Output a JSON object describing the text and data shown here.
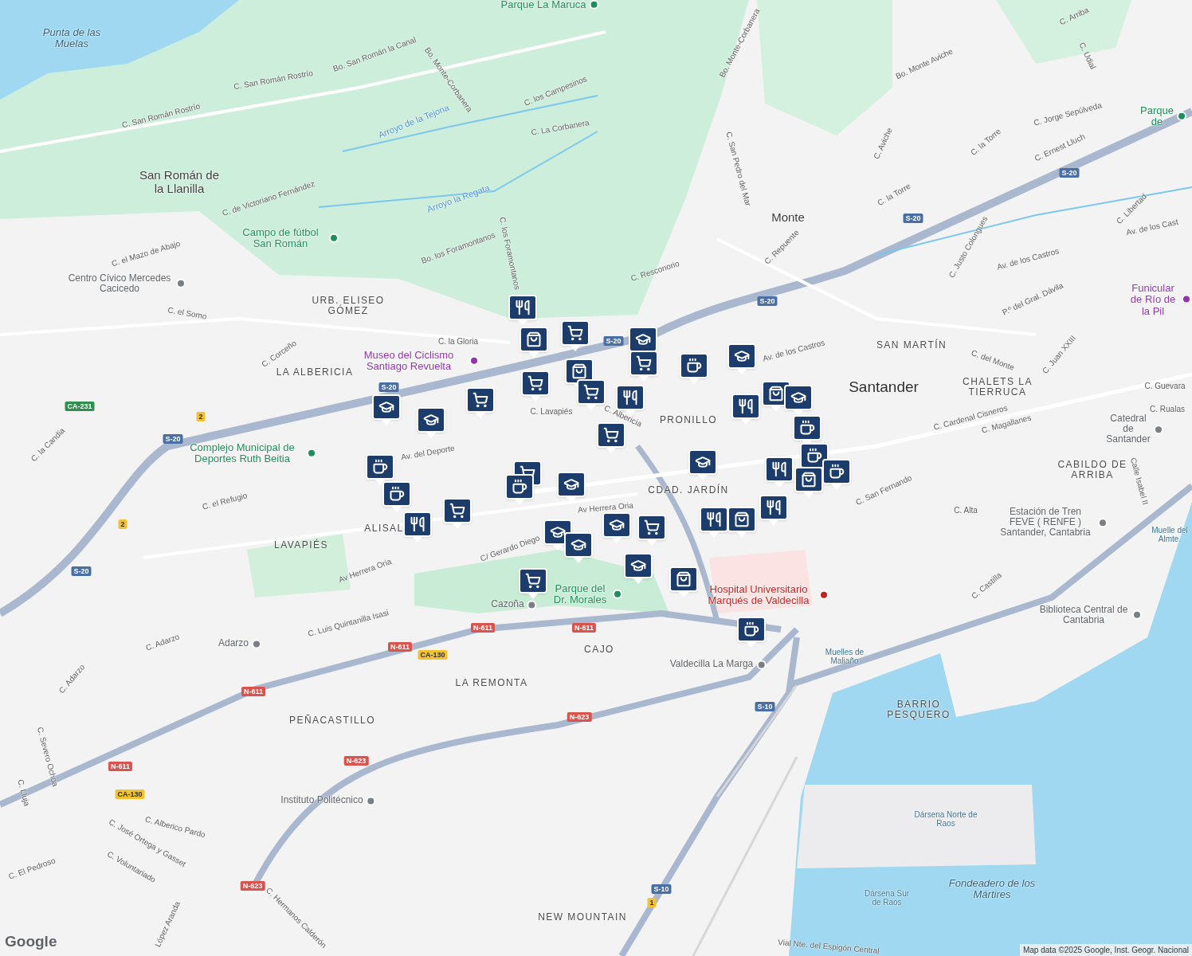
{
  "labels": [
    {
      "text": "Punta de las Muelas",
      "kind": "water"
    },
    {
      "text": "Parque La Maruca",
      "kind": "poi_green"
    },
    {
      "text": "C. San Román Rostrío",
      "kind": "street"
    },
    {
      "text": "C. San Román Rostrío",
      "kind": "street"
    },
    {
      "text": "Bo. San Román la Canal",
      "kind": "street"
    },
    {
      "text": "Bo. Monte-Corbanera",
      "kind": "street"
    },
    {
      "text": "Bo. Monte-Corbanera",
      "kind": "street"
    },
    {
      "text": "C. los Campesinos",
      "kind": "street"
    },
    {
      "text": "C. La Corbanera",
      "kind": "street"
    },
    {
      "text": "Arroyo de la Tejona",
      "kind": "stream"
    },
    {
      "text": "Arroyo la Regata",
      "kind": "stream"
    },
    {
      "text": "San Román de la Llanilla",
      "kind": "place"
    },
    {
      "text": "C. de Victoriano Fernández",
      "kind": "street"
    },
    {
      "text": "Campo de fútbol San Román",
      "kind": "poi_green"
    },
    {
      "text": "C. el Mazo de Abajo",
      "kind": "street"
    },
    {
      "text": "Centro Cívico Mercedes Cacicedo",
      "kind": "poi_gray"
    },
    {
      "text": "C. el Somo",
      "kind": "street"
    },
    {
      "text": "Bo. los Foramontanos",
      "kind": "street"
    },
    {
      "text": "C. los Foramontanos",
      "kind": "street"
    },
    {
      "text": "URB. ELISEO GÓMEZ",
      "kind": "district"
    },
    {
      "text": "Museo del Ciclismo Santiago Revuelta",
      "kind": "poi_purple"
    },
    {
      "text": "C. la Gloria",
      "kind": "street"
    },
    {
      "text": "C. Corceño",
      "kind": "street"
    },
    {
      "text": "LA ALBERICIA",
      "kind": "district"
    },
    {
      "text": "C. San Pedro del Mar",
      "kind": "street"
    },
    {
      "text": "C. Resconorio",
      "kind": "street"
    },
    {
      "text": "C. Repuente",
      "kind": "street"
    },
    {
      "text": "Monte",
      "kind": "place"
    },
    {
      "text": "Bo. Monte Aviche",
      "kind": "street"
    },
    {
      "text": "C. Aviche",
      "kind": "street"
    },
    {
      "text": "C. la Torre",
      "kind": "street"
    },
    {
      "text": "C. la Torre",
      "kind": "street"
    },
    {
      "text": "C. Arriba",
      "kind": "street"
    },
    {
      "text": "C. Udial",
      "kind": "street"
    },
    {
      "text": "C. Jorge Sepúlveda",
      "kind": "street"
    },
    {
      "text": "C. Ernest Lluch",
      "kind": "street"
    },
    {
      "text": "Parque de",
      "kind": "poi_green"
    },
    {
      "text": "C. Justo Colongues",
      "kind": "street"
    },
    {
      "text": "Av. de los Castros",
      "kind": "street"
    },
    {
      "text": "C. Libertad",
      "kind": "street"
    },
    {
      "text": "Av. de los Cast",
      "kind": "street"
    },
    {
      "text": "Funicular de Río de la Pil",
      "kind": "poi_purple"
    },
    {
      "text": "P.º del Gral. Dávila",
      "kind": "street"
    },
    {
      "text": "SAN MARTÍN",
      "kind": "district"
    },
    {
      "text": "C. Juan XXIII",
      "kind": "street"
    },
    {
      "text": "C. del Monte",
      "kind": "street"
    },
    {
      "text": "Santander",
      "kind": "city"
    },
    {
      "text": "CHALETS LA TIERRUCA",
      "kind": "district"
    },
    {
      "text": "C. Guevara",
      "kind": "street"
    },
    {
      "text": "C. Rualas",
      "kind": "street"
    },
    {
      "text": "C. Cardenal Cisneros",
      "kind": "street"
    },
    {
      "text": "C. Magallanes",
      "kind": "street"
    },
    {
      "text": "Catedral de Santander",
      "kind": "poi_gray"
    },
    {
      "text": "CABILDO DE ARRIBA",
      "kind": "district"
    },
    {
      "text": "Calle Isabel II",
      "kind": "street"
    },
    {
      "text": "C. San Fernando",
      "kind": "street"
    },
    {
      "text": "C. Alta",
      "kind": "street"
    },
    {
      "text": "Estación de Tren FEVE ( RENFE ) Santander, Cantabria",
      "kind": "poi_gray"
    },
    {
      "text": "Muelle del Almte.",
      "kind": "water_small"
    },
    {
      "text": "C. Castilla",
      "kind": "street"
    },
    {
      "text": "Biblioteca Central de Cantabria",
      "kind": "poi_gray"
    },
    {
      "text": "Muelles de Maliaño",
      "kind": "water_small"
    },
    {
      "text": "BARRIO PESQUERO",
      "kind": "district"
    },
    {
      "text": "Dársena Norte de Raos",
      "kind": "water_small"
    },
    {
      "text": "Dársena Sur de Raos",
      "kind": "water_small"
    },
    {
      "text": "Fondeadero de los Mártires",
      "kind": "water"
    },
    {
      "text": "Vial Nte. del Espigón Central",
      "kind": "street"
    },
    {
      "text": "NEW MOUNTAIN",
      "kind": "district"
    },
    {
      "text": "PRONILLO",
      "kind": "district"
    },
    {
      "text": "CDAD. JARDÍN",
      "kind": "district"
    },
    {
      "text": "Hospital Universitario Marqués de Valdecilla",
      "kind": "poi_red"
    },
    {
      "text": "Valdecilla La Marga",
      "kind": "poi_gray"
    },
    {
      "text": "C. Lavapiés",
      "kind": "street"
    },
    {
      "text": "C. Albericia",
      "kind": "street"
    },
    {
      "text": "Av Herrera Oria",
      "kind": "street"
    },
    {
      "text": "C/ Gerardo Diego",
      "kind": "street"
    },
    {
      "text": "Parque del Dr. Morales",
      "kind": "poi_green"
    },
    {
      "text": "Cazoña",
      "kind": "poi_gray"
    },
    {
      "text": "CAJO",
      "kind": "district"
    },
    {
      "text": "LA REMONTA",
      "kind": "district"
    },
    {
      "text": "PEÑACASTILLO",
      "kind": "district"
    },
    {
      "text": "C. Luis Quintanilla Isasi",
      "kind": "street"
    },
    {
      "text": "Adarzo",
      "kind": "poi_gray"
    },
    {
      "text": "C. Adarzo",
      "kind": "street"
    },
    {
      "text": "C. Adarzo",
      "kind": "street"
    },
    {
      "text": "Av Herrera Oria",
      "kind": "street"
    },
    {
      "text": "LAVAPIÉS",
      "kind": "district"
    },
    {
      "text": "ALISAL",
      "kind": "district"
    },
    {
      "text": "C. el Refugio",
      "kind": "street"
    },
    {
      "text": "Av. del Deporte",
      "kind": "street"
    },
    {
      "text": "Complejo Municipal de Deportes Ruth Beitia",
      "kind": "poi_green"
    },
    {
      "text": "C. la Candia",
      "kind": "street"
    },
    {
      "text": "C. Severo Ochoa",
      "kind": "street"
    },
    {
      "text": "C. Lluja",
      "kind": "street"
    },
    {
      "text": "Instituto Politécnico",
      "kind": "poi_gray"
    },
    {
      "text": "C. Alberico Pardo",
      "kind": "street"
    },
    {
      "text": "C. José Ortega y Gasset",
      "kind": "street"
    },
    {
      "text": "C. Voluntariado",
      "kind": "street"
    },
    {
      "text": "C. El Pedroso",
      "kind": "street"
    },
    {
      "text": "López Aranda",
      "kind": "street"
    },
    {
      "text": "C. Hermanos Calderón",
      "kind": "street"
    },
    {
      "text": "Av. de los Castros",
      "kind": "street"
    }
  ],
  "roads": [
    {
      "text": "S-20",
      "kind": "autovia"
    },
    {
      "text": "S-20",
      "kind": "autovia"
    },
    {
      "text": "S-20",
      "kind": "autovia"
    },
    {
      "text": "S-20",
      "kind": "autovia"
    },
    {
      "text": "S-20",
      "kind": "autovia"
    },
    {
      "text": "S-20",
      "kind": "autovia"
    },
    {
      "text": "S-20",
      "kind": "autovia"
    },
    {
      "text": "N-611",
      "kind": "nacional"
    },
    {
      "text": "N-611",
      "kind": "nacional"
    },
    {
      "text": "N-611",
      "kind": "nacional"
    },
    {
      "text": "N-611",
      "kind": "nacional"
    },
    {
      "text": "N-611",
      "kind": "nacional"
    },
    {
      "text": "N-623",
      "kind": "nacional"
    },
    {
      "text": "N-623",
      "kind": "nacional"
    },
    {
      "text": "N-623",
      "kind": "nacional"
    },
    {
      "text": "CA-130",
      "kind": "autonomica"
    },
    {
      "text": "CA-130",
      "kind": "autonomica"
    },
    {
      "text": "CA-231",
      "kind": "regional"
    },
    {
      "text": "S-10",
      "kind": "autovia"
    },
    {
      "text": "S-10",
      "kind": "autovia"
    },
    {
      "text": "2",
      "kind": "local"
    },
    {
      "text": "2",
      "kind": "local"
    },
    {
      "text": "1",
      "kind": "local"
    }
  ],
  "markers": [
    {
      "kind": "restaurant"
    },
    {
      "kind": "shop"
    },
    {
      "kind": "grocery"
    },
    {
      "kind": "school"
    },
    {
      "kind": "grocery"
    },
    {
      "kind": "cafe"
    },
    {
      "kind": "school"
    },
    {
      "kind": "grocery"
    },
    {
      "kind": "shop"
    },
    {
      "kind": "grocery"
    },
    {
      "kind": "restaurant"
    },
    {
      "kind": "grocery"
    },
    {
      "kind": "school"
    },
    {
      "kind": "school"
    },
    {
      "kind": "grocery"
    },
    {
      "kind": "restaurant"
    },
    {
      "kind": "shop"
    },
    {
      "kind": "school"
    },
    {
      "kind": "cafe"
    },
    {
      "kind": "cafe"
    },
    {
      "kind": "cafe"
    },
    {
      "kind": "shop"
    },
    {
      "kind": "restaurant"
    },
    {
      "kind": "school"
    },
    {
      "kind": "restaurant"
    },
    {
      "kind": "shop"
    },
    {
      "kind": "restaurant"
    },
    {
      "kind": "cafe"
    },
    {
      "kind": "cafe"
    },
    {
      "kind": "grocery"
    },
    {
      "kind": "cafe"
    },
    {
      "kind": "school"
    },
    {
      "kind": "grocery"
    },
    {
      "kind": "restaurant"
    },
    {
      "kind": "school"
    },
    {
      "kind": "school"
    },
    {
      "kind": "school"
    },
    {
      "kind": "grocery"
    },
    {
      "kind": "school"
    },
    {
      "kind": "shop"
    },
    {
      "kind": "grocery"
    },
    {
      "kind": "cafe"
    }
  ],
  "attribution": {
    "logo": "Google",
    "text": "Map data ©2025 Google, Inst. Geogr. Nacional"
  }
}
